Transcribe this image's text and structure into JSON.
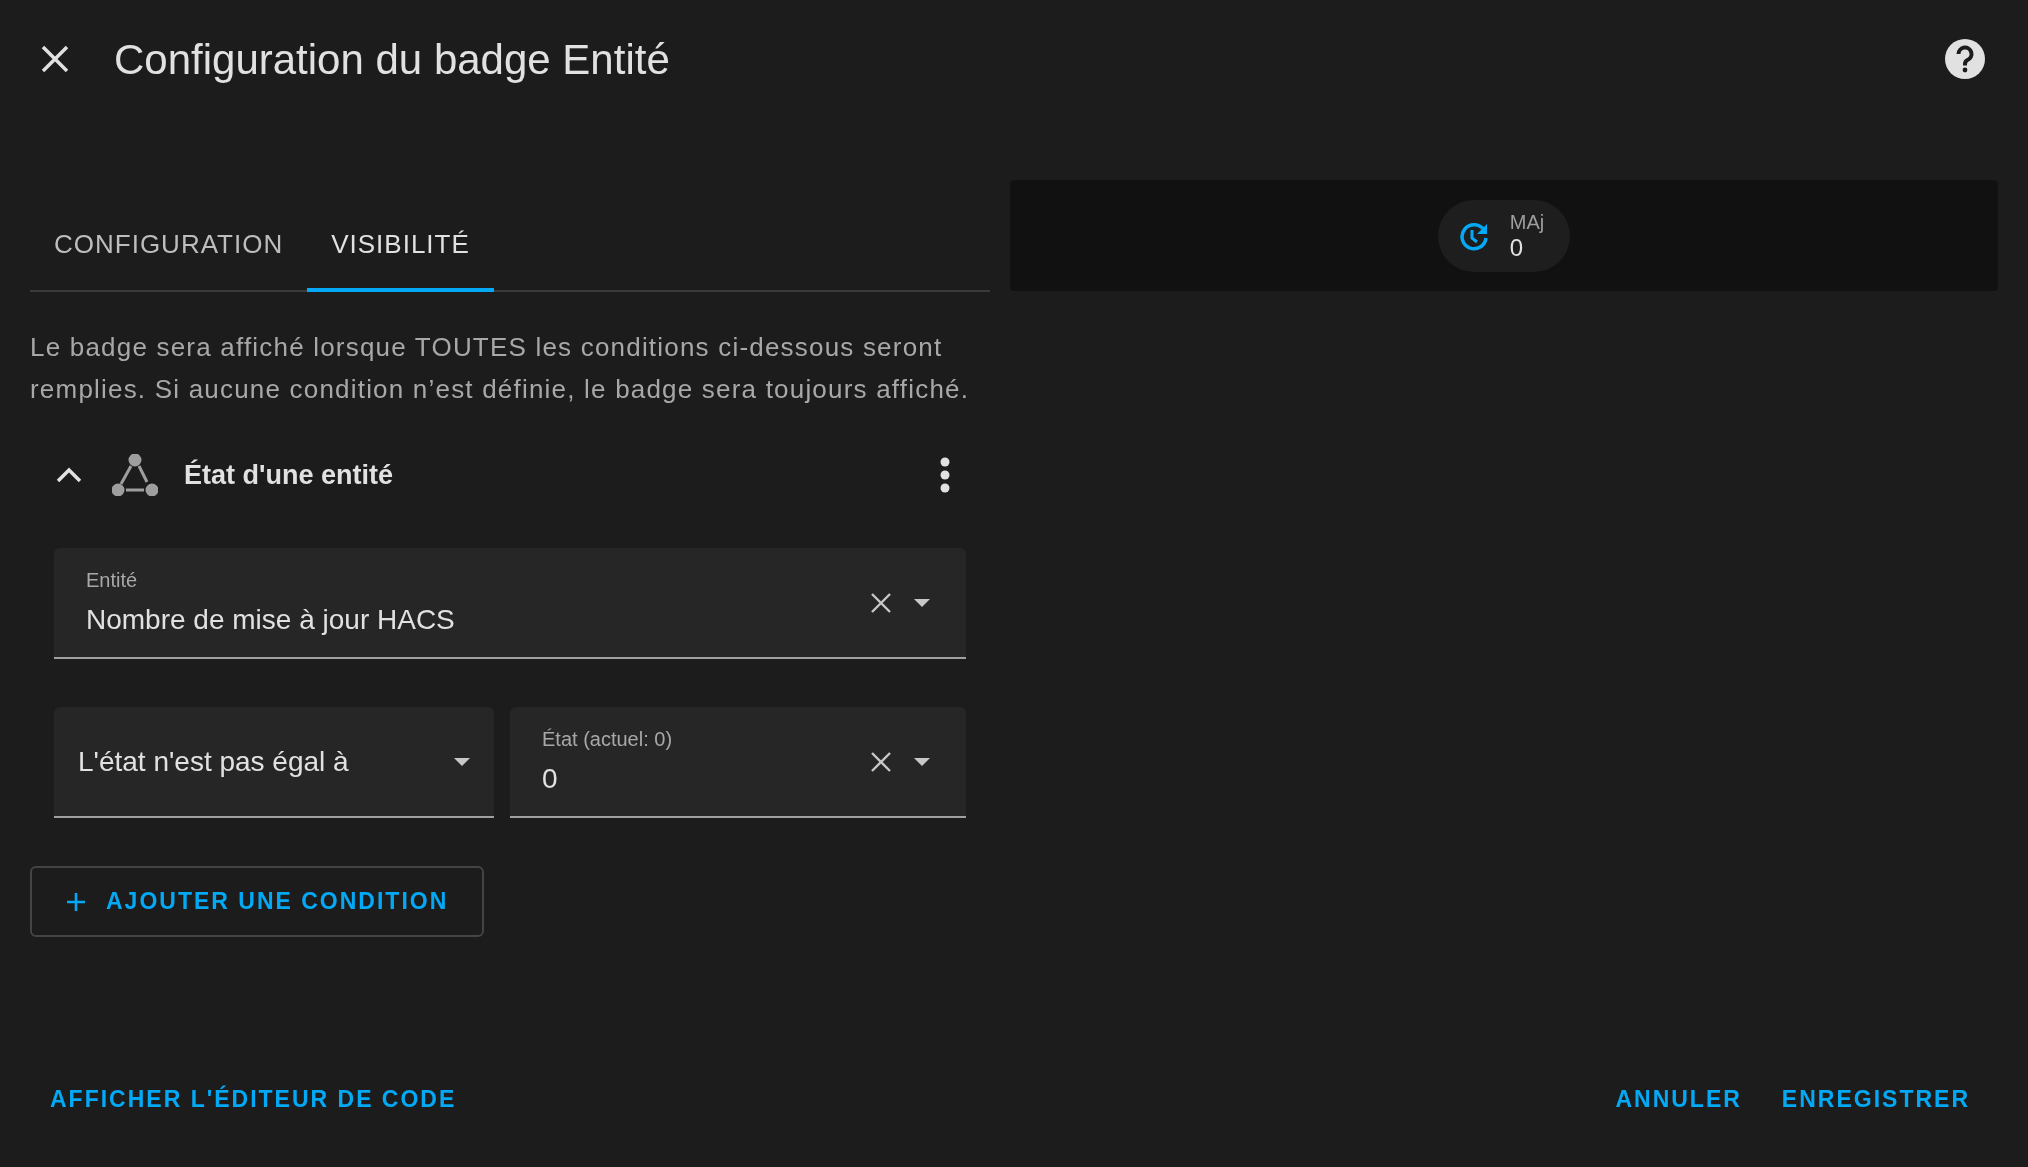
{
  "dialog": {
    "title": "Configuration du badge Entité"
  },
  "tabs": [
    {
      "label": "CONFIGURATION",
      "selected": false
    },
    {
      "label": "VISIBILITÉ",
      "selected": true
    }
  ],
  "description": "Le badge sera affiché lorsque TOUTES les conditions ci-dessous seront remplies. Si aucune condition n’est définie, le badge sera toujours affiché.",
  "condition": {
    "title": "État d'une entité",
    "expanded": true,
    "entity_field": {
      "label": "Entité",
      "value": "Nombre de mise à jour HACS"
    },
    "operator_field": {
      "value": "L'état n'est pas égal à"
    },
    "state_field": {
      "label": "État (actuel: 0)",
      "value": "0"
    }
  },
  "add_button": "AJOUTER UNE CONDITION",
  "preview_badge": {
    "name": "MAj",
    "value": "0"
  },
  "footer": {
    "code_editor": "AFFICHER L'ÉDITEUR DE CODE",
    "buttons": [
      "ANNULER",
      "ENREGISTRER"
    ]
  }
}
